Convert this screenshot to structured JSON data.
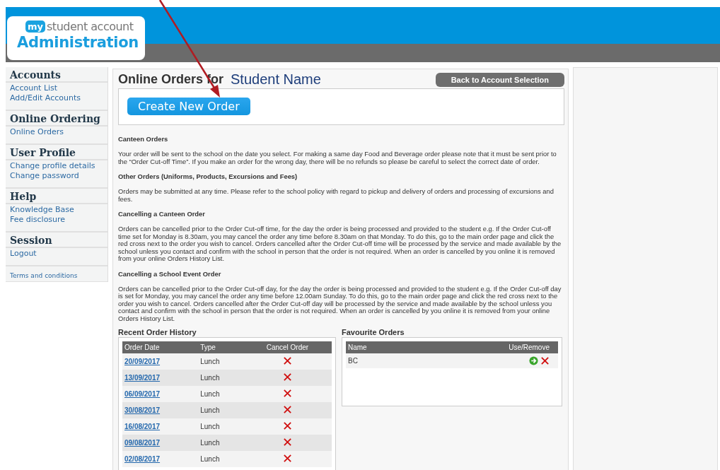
{
  "logo": {
    "badge": "my",
    "brand": "student account",
    "title": "Administration"
  },
  "sidebar": {
    "sections": [
      {
        "heading": "Accounts",
        "links": [
          "Account List",
          "Add/Edit Accounts"
        ]
      },
      {
        "heading": "Online Ordering",
        "links": [
          "Online Orders"
        ]
      },
      {
        "heading": "User Profile",
        "links": [
          "Change profile details",
          "Change password"
        ]
      },
      {
        "heading": "Help",
        "links": [
          "Knowledge Base",
          "Fee disclosure"
        ]
      },
      {
        "heading": "Session",
        "links": [
          "Logout"
        ]
      }
    ],
    "footer_link": "Terms and conditions"
  },
  "page": {
    "title": "Online Orders for",
    "student": "Student Name",
    "back_button": "Back to Account Selection",
    "create_button": "Create New Order"
  },
  "info": [
    {
      "heading": "Canteen Orders",
      "text": "Your order will be sent to the school on the date you select. For making a same day Food and Beverage order please note that it must be sent prior to the “Order Cut-off Time”. If you make an order for the wrong day, there will be no refunds so please be careful to select the correct date of order."
    },
    {
      "heading": "Other Orders (Uniforms, Products, Excursions and Fees)",
      "text": "Orders may be submitted at any time. Please refer to the school policy with regard to pickup and delivery of orders and processing of excursions and fees."
    },
    {
      "heading": "Cancelling a Canteen Order",
      "text": "Orders can be cancelled prior to the Order Cut-off time, for the day the order is being processed and provided to the student e.g. If the Order Cut-off time set for Monday is 8.30am, you may cancel the order any time before 8.30am on that Monday. To do this, go to the main order page and click the red cross next to the order you wish to cancel. Orders cancelled after the Order Cut-off time will be processed by the service and made available by the school unless you contact and confirm with the school in person that the order is not required. When an order is cancelled by you online it is removed from your online Orders History List."
    },
    {
      "heading": "Cancelling a School Event Order",
      "text": "Orders can be cancelled prior to the Order Cut-off day, for the day the order is being processed and provided to the student e.g. If the Order Cut-off day is set for Monday, you may cancel the order any time before 12.00am Sunday. To do this, go to the main order page and click the red cross next to the order you wish to cancel. Orders cancelled after the Order Cut-off day will be processed by the service and made available by the school unless you contact and confirm with the school in person that the order is not required. When an order is cancelled by you online it is removed from your online Orders History List."
    }
  ],
  "recent_orders": {
    "title": "Recent Order History",
    "columns": [
      "Order Date",
      "Type",
      "Cancel Order"
    ],
    "rows": [
      {
        "date": "20/09/2017",
        "type": "Lunch"
      },
      {
        "date": "13/09/2017",
        "type": "Lunch"
      },
      {
        "date": "06/09/2017",
        "type": "Lunch"
      },
      {
        "date": "30/08/2017",
        "type": "Lunch"
      },
      {
        "date": "16/08/2017",
        "type": "Lunch"
      },
      {
        "date": "09/08/2017",
        "type": "Lunch"
      },
      {
        "date": "02/08/2017",
        "type": "Lunch"
      }
    ]
  },
  "favourite_orders": {
    "title": "Favourite Orders",
    "columns": [
      "Name",
      "Use/Remove"
    ],
    "rows": [
      {
        "name": "BC"
      }
    ]
  }
}
